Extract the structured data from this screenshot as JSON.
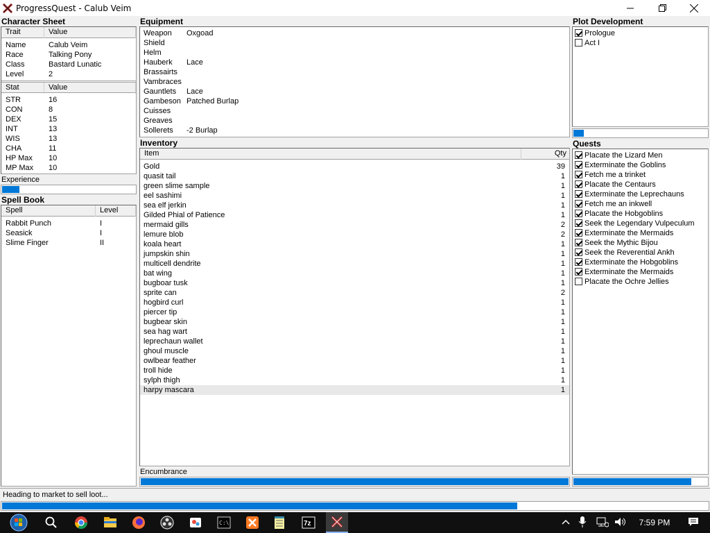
{
  "window": {
    "title": "ProgressQuest - Calub Veim"
  },
  "character_sheet": {
    "title": "Character Sheet",
    "trait_header": [
      "Trait",
      "Value"
    ],
    "traits": [
      [
        "Name",
        "Calub Veim"
      ],
      [
        "Race",
        "Talking Pony"
      ],
      [
        "Class",
        "Bastard Lunatic"
      ],
      [
        "Level",
        "2"
      ]
    ],
    "stat_header": [
      "Stat",
      "Value"
    ],
    "stats": [
      [
        "STR",
        "16"
      ],
      [
        "CON",
        "8"
      ],
      [
        "DEX",
        "15"
      ],
      [
        "INT",
        "13"
      ],
      [
        "WIS",
        "13"
      ],
      [
        "CHA",
        "11"
      ],
      [
        "HP Max",
        "10"
      ],
      [
        "MP Max",
        "10"
      ]
    ],
    "experience_label": "Experience",
    "experience_progress": 0.13
  },
  "spell_book": {
    "title": "Spell Book",
    "header": [
      "Spell",
      "Level"
    ],
    "spells": [
      [
        "Rabbit Punch",
        "I"
      ],
      [
        "Seasick",
        "I"
      ],
      [
        "Slime Finger",
        "II"
      ]
    ]
  },
  "equipment": {
    "title": "Equipment",
    "items": [
      [
        "Weapon",
        "Oxgoad"
      ],
      [
        "Shield",
        ""
      ],
      [
        "Helm",
        ""
      ],
      [
        "Hauberk",
        "Lace"
      ],
      [
        "Brassairts",
        ""
      ],
      [
        "Vambraces",
        ""
      ],
      [
        "Gauntlets",
        "Lace"
      ],
      [
        "Gambeson",
        "Patched Burlap"
      ],
      [
        "Cuisses",
        ""
      ],
      [
        "Greaves",
        ""
      ],
      [
        "Sollerets",
        "-2 Burlap"
      ]
    ]
  },
  "inventory": {
    "title": "Inventory",
    "header": [
      "Item",
      "Qty"
    ],
    "items": [
      [
        "Gold",
        "39"
      ],
      [
        "quasit tail",
        "1"
      ],
      [
        "green slime sample",
        "1"
      ],
      [
        "eel sashimi",
        "1"
      ],
      [
        "sea elf jerkin",
        "1"
      ],
      [
        "Gilded Phial of Patience",
        "1"
      ],
      [
        "mermaid gills",
        "2"
      ],
      [
        "lemure blob",
        "2"
      ],
      [
        "koala heart",
        "1"
      ],
      [
        "jumpskin shin",
        "1"
      ],
      [
        "multicell dendrite",
        "1"
      ],
      [
        "bat wing",
        "1"
      ],
      [
        "bugboar tusk",
        "1"
      ],
      [
        "sprite can",
        "2"
      ],
      [
        "hogbird curl",
        "1"
      ],
      [
        "piercer tip",
        "1"
      ],
      [
        "bugbear skin",
        "1"
      ],
      [
        "sea hag wart",
        "1"
      ],
      [
        "leprechaun wallet",
        "1"
      ],
      [
        "ghoul muscle",
        "1"
      ],
      [
        "owlbear feather",
        "1"
      ],
      [
        "troll hide",
        "1"
      ],
      [
        "sylph thigh",
        "1"
      ],
      [
        "harpy mascara",
        "1"
      ]
    ],
    "encumbrance_label": "Encumbrance",
    "encumbrance_progress": 1.0
  },
  "plot": {
    "title": "Plot Development",
    "acts": [
      {
        "label": "Prologue",
        "checked": true
      },
      {
        "label": "Act I",
        "checked": false
      }
    ],
    "progress": 0.08
  },
  "quests": {
    "title": "Quests",
    "items": [
      {
        "label": "Placate the Lizard Men",
        "checked": true
      },
      {
        "label": "Exterminate the Goblins",
        "checked": true
      },
      {
        "label": "Fetch me a trinket",
        "checked": true
      },
      {
        "label": "Placate the Centaurs",
        "checked": true
      },
      {
        "label": "Exterminate the Leprechauns",
        "checked": true
      },
      {
        "label": "Fetch me an inkwell",
        "checked": true
      },
      {
        "label": "Placate the Hobgoblins",
        "checked": true
      },
      {
        "label": "Seek the Legendary Vulpeculum",
        "checked": true
      },
      {
        "label": "Exterminate the Mermaids",
        "checked": true
      },
      {
        "label": "Seek the Mythic Bijou",
        "checked": true
      },
      {
        "label": "Seek the Reverential Ankh",
        "checked": true
      },
      {
        "label": "Exterminate the Hobgoblins",
        "checked": true
      },
      {
        "label": "Exterminate the Mermaids",
        "checked": true
      },
      {
        "label": "Placate the Ochre Jellies",
        "checked": false
      }
    ],
    "progress": 0.88
  },
  "status": {
    "text": "Heading to market to sell loot...",
    "progress": 0.73
  },
  "taskbar": {
    "time": "7:59 PM",
    "icons": [
      "windows-start-icon",
      "search-icon",
      "chrome-icon",
      "file-explorer-icon",
      "firefox-icon",
      "obs-icon",
      "paint-icon",
      "terminal-icon",
      "xampp-icon",
      "notepad-icon",
      "7zip-icon",
      "progressquest-icon"
    ]
  },
  "colors": {
    "accent": "#0078d7",
    "taskbar": "#101010"
  }
}
